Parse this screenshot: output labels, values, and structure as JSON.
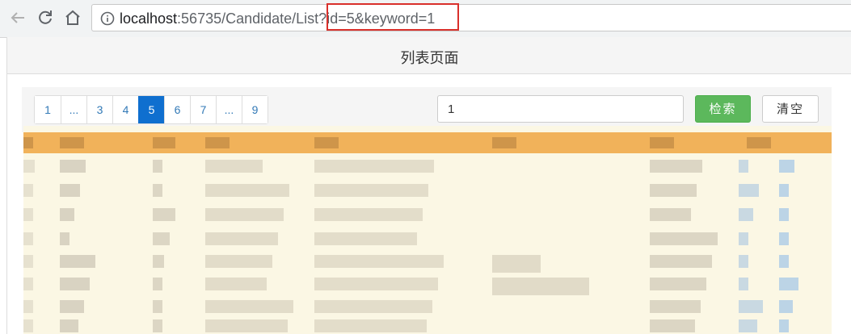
{
  "browser": {
    "url_host": "localhost",
    "url_path": ":56735/Candidate/List?id=5&keyword=1"
  },
  "panel": {
    "title": "列表页面"
  },
  "pagination": {
    "items": [
      "1",
      "...",
      "3",
      "4",
      "5",
      "6",
      "7",
      "...",
      "9"
    ],
    "active": "5"
  },
  "search": {
    "value": "1"
  },
  "buttons": {
    "search_label": "检索",
    "clear_label": "清空"
  },
  "colors": {
    "accent_blue": "#0f6fcf",
    "search_green": "#5cb85c",
    "highlight_red": "#d9302b",
    "table_header": "#f1b25a"
  }
}
